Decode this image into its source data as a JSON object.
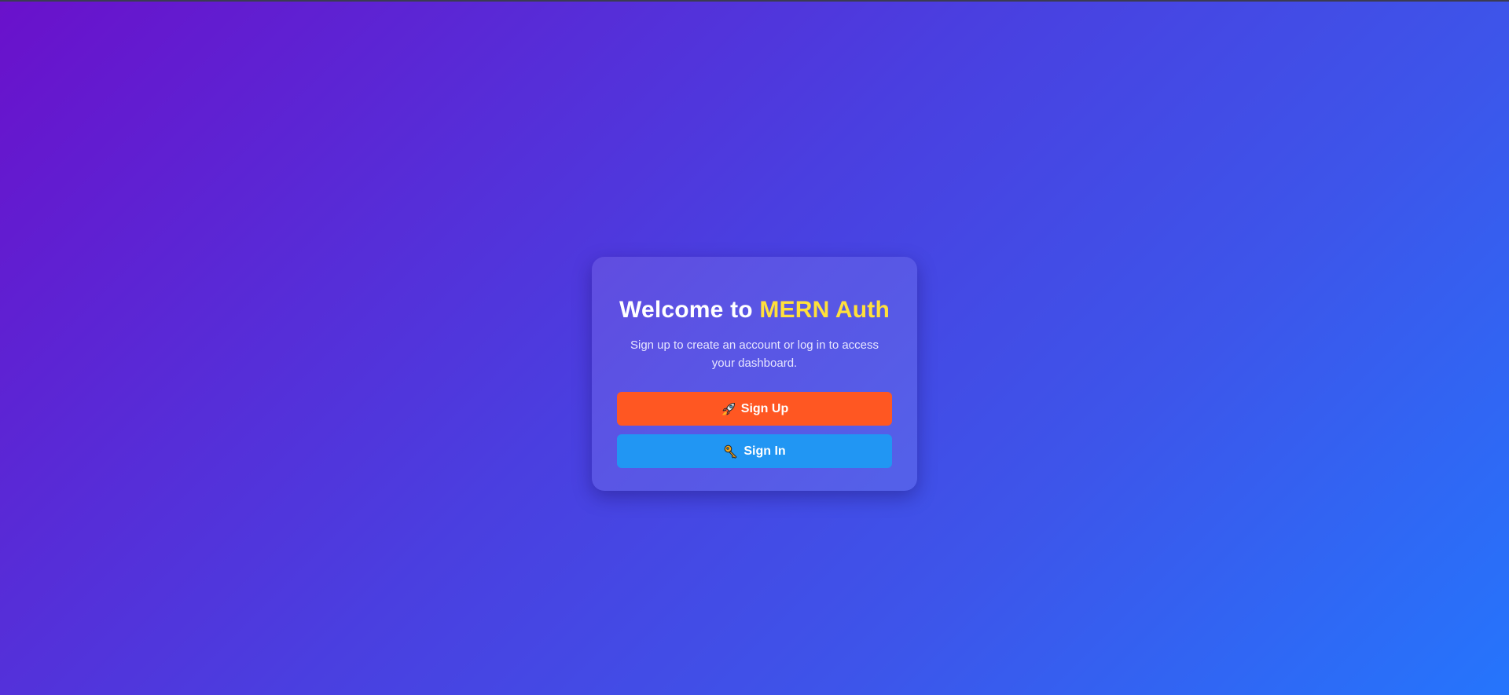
{
  "card": {
    "title_prefix": "Welcome to",
    "title_brand": "MERN Auth",
    "subtitle": "Sign up to create an account or log in to access your dashboard."
  },
  "buttons": {
    "signup": {
      "label": "Sign Up",
      "icon": "rocket-icon",
      "color": "#ff5722"
    },
    "signin": {
      "label": "Sign In",
      "icon": "key-icon",
      "color": "#2196f3"
    }
  },
  "colors": {
    "brand": "#ffe03b",
    "gradient_start": "#6a11cb",
    "gradient_end": "#2575fc"
  }
}
